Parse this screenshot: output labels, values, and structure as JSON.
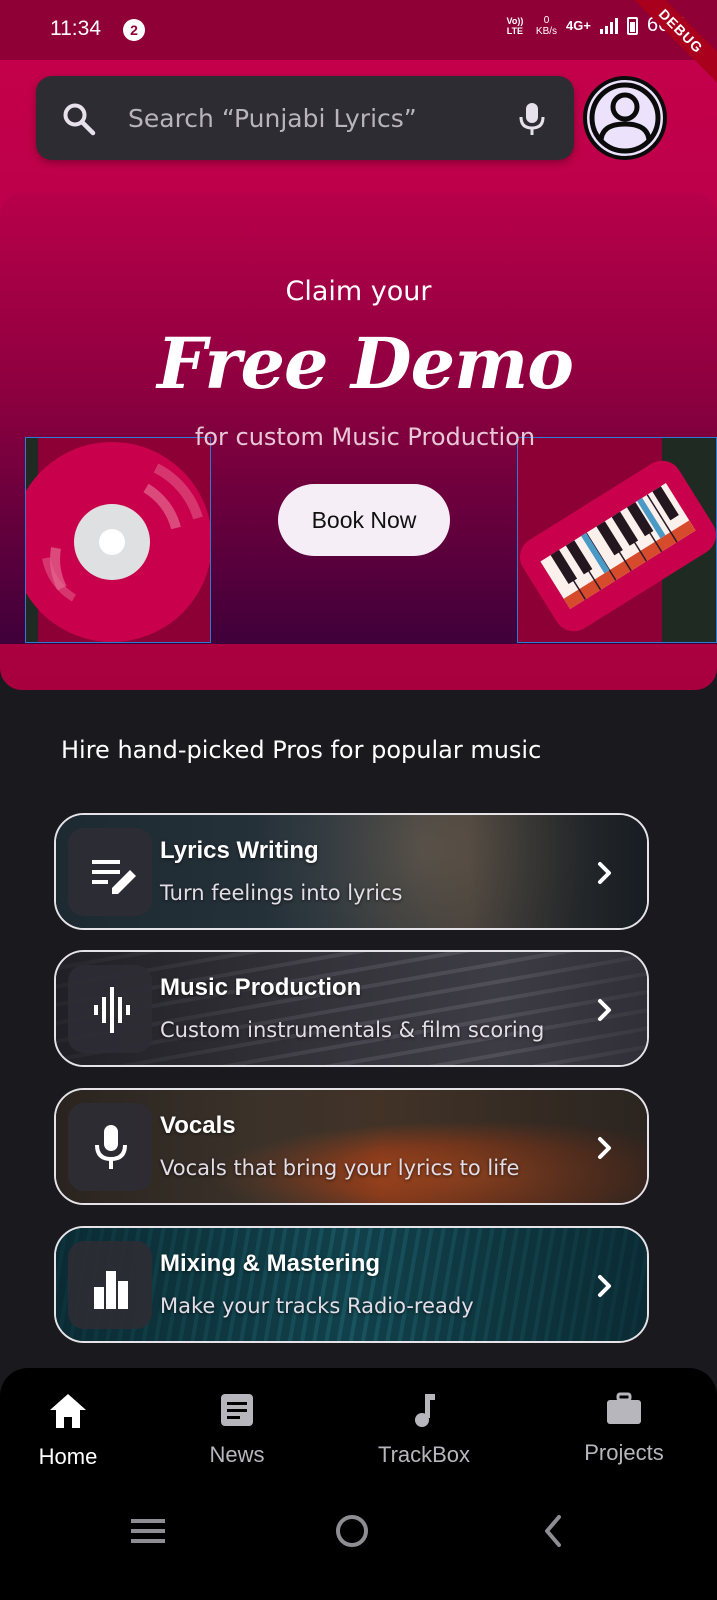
{
  "status_bar": {
    "time": "11:34",
    "notification_count": "2",
    "volte_label": "Vo)) LTE",
    "net_speed_value": "0",
    "net_speed_unit": "KB/s",
    "network_type": "4G+",
    "battery": "66%",
    "debug_label": "DEBUG"
  },
  "search": {
    "placeholder": "Search “Punjabi Lyrics”"
  },
  "banner": {
    "claim_text": "Claim your",
    "headline": "Free Demo",
    "subtext": "for custom Music Production",
    "cta_label": "Book Now"
  },
  "section": {
    "title": "Hire hand-picked Pros for popular music"
  },
  "services": [
    {
      "title": "Lyrics Writing",
      "subtitle": "Turn feelings into lyrics",
      "icon": "edit-notes-icon"
    },
    {
      "title": "Music Production",
      "subtitle": "Custom instrumentals & film scoring",
      "icon": "waveform-icon"
    },
    {
      "title": "Vocals",
      "subtitle": "Vocals that bring your lyrics to life",
      "icon": "microphone-icon"
    },
    {
      "title": "Mixing & Mastering",
      "subtitle": "Make your tracks Radio-ready",
      "icon": "bar-chart-icon"
    }
  ],
  "bottom_nav": {
    "items": [
      {
        "label": "Home",
        "icon": "home-icon",
        "active": true
      },
      {
        "label": "News",
        "icon": "article-icon",
        "active": false
      },
      {
        "label": "TrackBox",
        "icon": "music-note-icon",
        "active": false
      },
      {
        "label": "Projects",
        "icon": "briefcase-icon",
        "active": false
      }
    ]
  },
  "colors": {
    "brand": "#c4004a",
    "background": "#1a191d",
    "nav_active": "#ffffff",
    "nav_inactive": "#b7b6bc"
  }
}
